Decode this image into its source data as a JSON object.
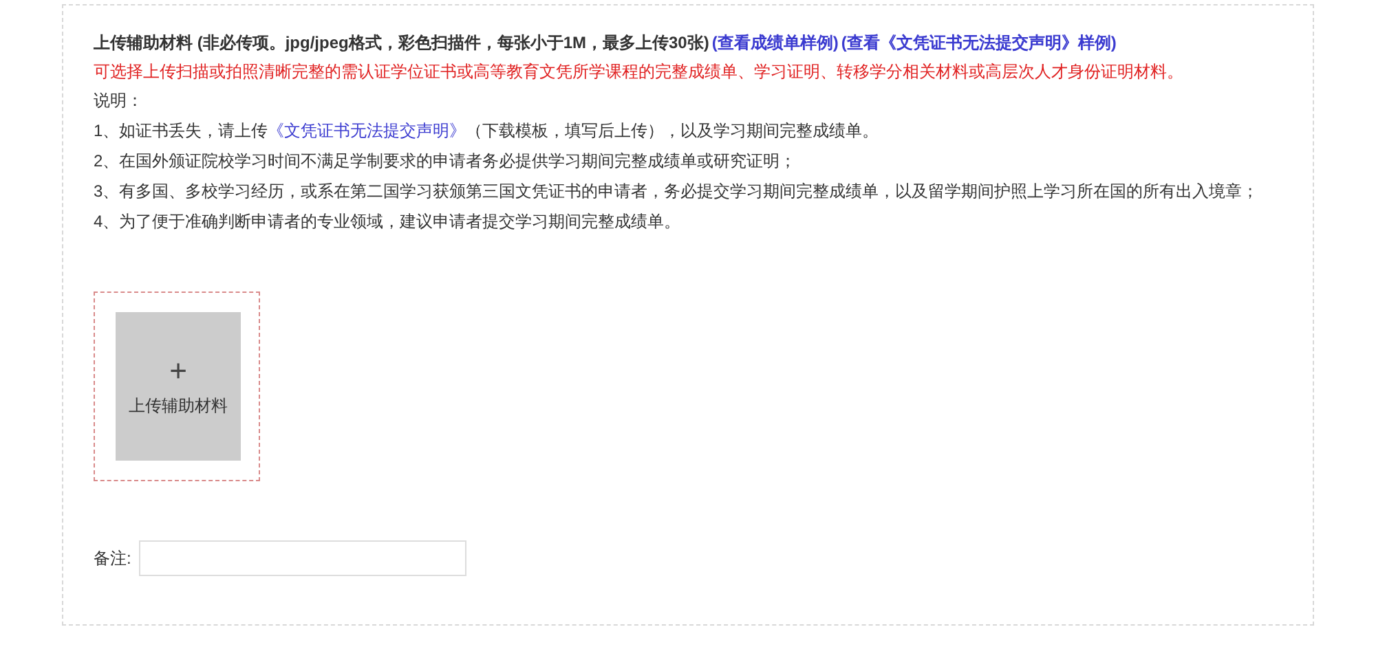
{
  "header": {
    "title": "上传辅助材料 (非必传项。jpg/jpeg格式，彩色扫描件，每张小于1M，最多上传30张)",
    "links": [
      "(查看成绩单样例)",
      "(查看《文凭证书无法提交声明》样例)"
    ]
  },
  "notice": "可选择上传扫描或拍照清晰完整的需认证学位证书或高等教育文凭所学课程的完整成绩单、学习证明、转移学分相关材料或高层次人才身份证明材料。",
  "instructions": {
    "heading": "说明：",
    "items": [
      {
        "parts": [
          {
            "kind": "text",
            "text": "1、如证书丢失，请上传"
          },
          {
            "kind": "link",
            "text": "《文凭证书无法提交声明》"
          },
          {
            "kind": "text",
            "text": "（下载模板，填写后上传），以及学习期间完整成绩单。"
          }
        ]
      },
      {
        "parts": [
          {
            "kind": "text",
            "text": "2、在国外颁证院校学习时间不满足学制要求的申请者务必提供学习期间完整成绩单或研究证明；"
          }
        ]
      },
      {
        "parts": [
          {
            "kind": "text",
            "text": "3、有多国、多校学习经历，或系在第二国学习获颁第三国文凭证书的申请者，务必提交学习期间完整成绩单，以及留学期间护照上学习所在国的所有出入境章；"
          }
        ]
      },
      {
        "parts": [
          {
            "kind": "text",
            "text": "4、为了便于准确判断申请者的专业领域，建议申请者提交学习期间完整成绩单。"
          }
        ]
      }
    ]
  },
  "upload": {
    "icon": "+",
    "label": "上传辅助材料"
  },
  "remark": {
    "label": "备注:"
  }
}
